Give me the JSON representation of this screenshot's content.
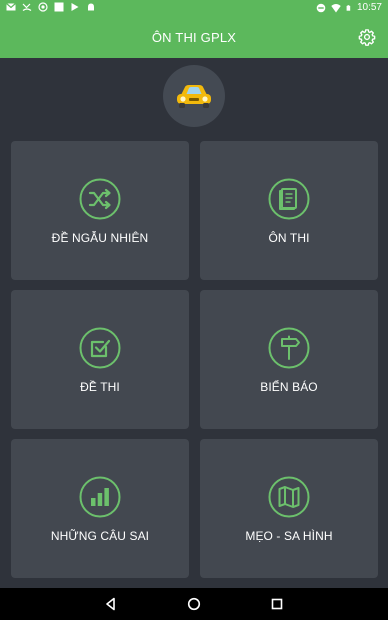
{
  "status_bar": {
    "time": "10:57",
    "left_icons": [
      "gmail-icon",
      "missed-call-icon",
      "sync-icon",
      "image-icon",
      "play-store-icon",
      "android-icon"
    ],
    "right_icons": [
      "do-not-disturb-icon",
      "wifi-icon",
      "battery-icon"
    ]
  },
  "app_bar": {
    "title": "ÔN THI GPLX",
    "settings_icon": "gear-icon"
  },
  "logo": {
    "icon": "car-icon"
  },
  "menu": {
    "tiles": [
      {
        "label": "ĐỀ NGẪU NHIÊN",
        "icon": "shuffle-icon"
      },
      {
        "label": "ÔN THI",
        "icon": "book-icon"
      },
      {
        "label": "ĐỀ THI",
        "icon": "checkbox-icon"
      },
      {
        "label": "BIỂN BÁO",
        "icon": "signpost-icon"
      },
      {
        "label": "NHỮNG CÂU SAI",
        "icon": "bar-chart-icon"
      },
      {
        "label": "MẸO - SA HÌNH",
        "icon": "map-icon"
      }
    ]
  },
  "nav_bar": {
    "buttons": [
      "back-icon",
      "home-icon",
      "recents-icon"
    ]
  },
  "colors": {
    "accent": "#5cb85c",
    "icon_green": "#6cc06c",
    "background": "#2f333b",
    "tile": "#434850",
    "logo_circle": "#444a53"
  }
}
